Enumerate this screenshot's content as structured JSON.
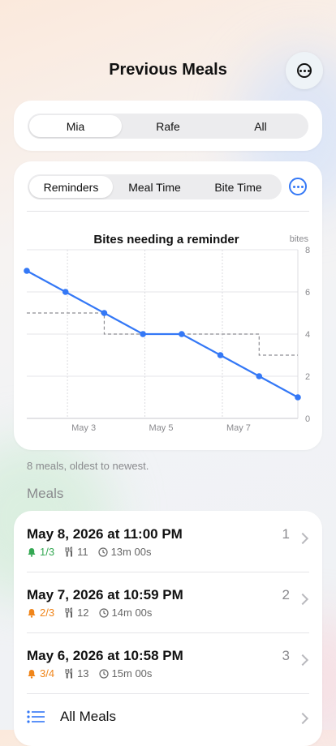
{
  "header": {
    "title": "Previous Meals",
    "more_icon": "ellipsis-circle-icon"
  },
  "person_picker": {
    "options": [
      "Mia",
      "Rafe",
      "All"
    ],
    "selected": 0
  },
  "chart_picker": {
    "options": [
      "Reminders",
      "Meal Time",
      "Bite Time"
    ],
    "selected": 0,
    "more_icon": "ellipsis-circle-icon"
  },
  "chart_data": {
    "type": "line",
    "title": "Bites needing a reminder",
    "ylabel": "bites",
    "ylim": [
      0,
      8
    ],
    "yticks": [
      "0",
      "2",
      "4",
      "6",
      "8"
    ],
    "xticks": [
      "May 3",
      "May 5",
      "May 7"
    ],
    "series": [
      {
        "values": [
          7,
          6,
          5,
          4,
          4,
          3,
          2,
          1
        ],
        "color": "#3478f6",
        "style": "solid"
      },
      {
        "values": [
          5,
          5,
          4,
          4,
          4,
          4,
          3,
          3
        ],
        "color": "#8e8e93",
        "style": "dashed-step"
      }
    ],
    "grid": true
  },
  "footnote": "8 meals, oldest to newest.",
  "meals_section": {
    "title": "Meals",
    "rows": [
      {
        "date": "May 8, 2026 at 11:00 PM",
        "count": "1",
        "reminders": "1/3",
        "reminder_color": "#34a853",
        "bites": "11",
        "duration": "13m 00s"
      },
      {
        "date": "May 7, 2026 at 10:59 PM",
        "count": "2",
        "reminders": "2/3",
        "reminder_color": "#f0851a",
        "bites": "12",
        "duration": "14m 00s"
      },
      {
        "date": "May 6, 2026 at 10:58 PM",
        "count": "3",
        "reminders": "3/4",
        "reminder_color": "#f0851a",
        "bites": "13",
        "duration": "15m 00s"
      }
    ],
    "all_label": "All Meals"
  },
  "colors": {
    "accent": "#3478f6",
    "green": "#34a853",
    "orange": "#f0851a"
  }
}
